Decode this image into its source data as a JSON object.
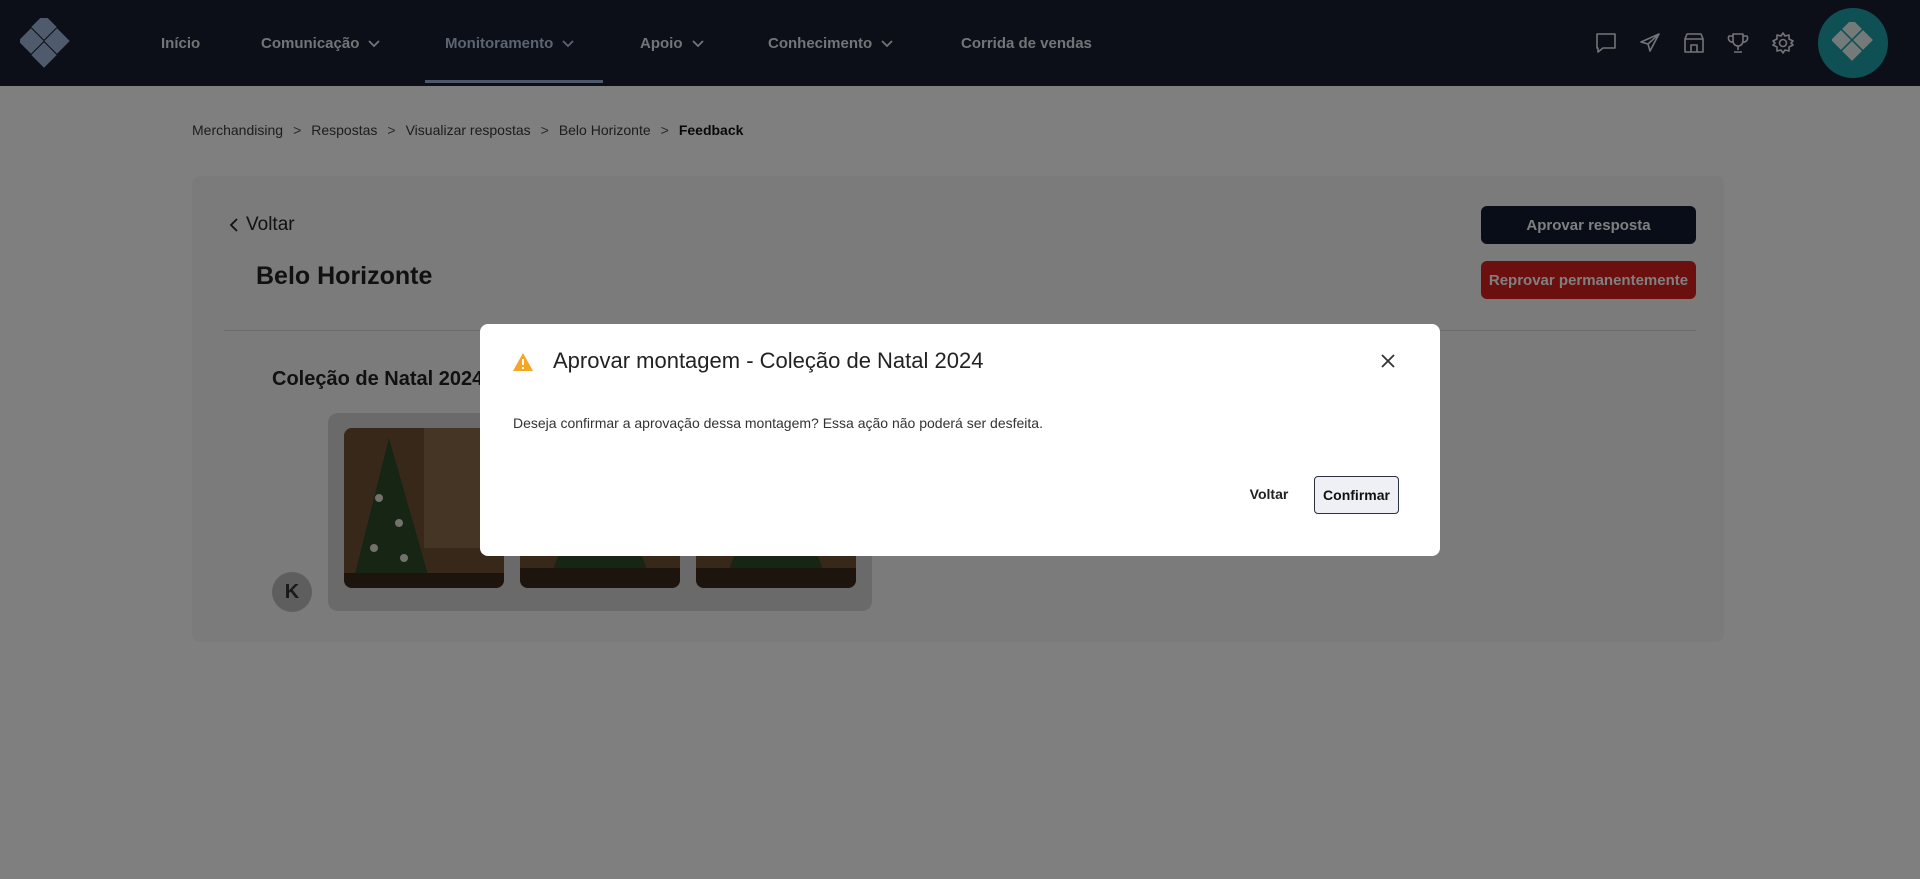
{
  "nav": {
    "items": [
      {
        "label": "Início"
      },
      {
        "label": "Comunicação"
      },
      {
        "label": "Monitoramento"
      },
      {
        "label": "Apoio"
      },
      {
        "label": "Conhecimento"
      },
      {
        "label": "Corrida de vendas"
      }
    ],
    "active_index": 2,
    "icons": [
      "chat-icon",
      "send-icon",
      "store-icon",
      "trophy-icon",
      "gear-icon"
    ]
  },
  "breadcrumb": {
    "items": [
      "Merchandising",
      "Respostas",
      "Visualizar respostas",
      "Belo Horizonte"
    ],
    "current": "Feedback",
    "separator": ">"
  },
  "page": {
    "back_label": "Voltar",
    "title": "Belo Horizonte",
    "approve_label": "Aprovar resposta",
    "reject_label": "Reprovar permanentemente",
    "section_title": "Coleção de Natal 2024",
    "user_initial": "K"
  },
  "modal": {
    "title": "Aprovar montagem - Coleção de Natal 2024",
    "message": "Deseja confirmar a aprovação dessa montagem? Essa ação não poderá ser desfeita.",
    "cancel_label": "Voltar",
    "confirm_label": "Confirmar"
  },
  "colors": {
    "topbar": "#1a1e30",
    "approve": "#111a2e",
    "reject": "#d81f1f",
    "warning": "#f5a623",
    "avatar_brand": "#1ea1a8"
  }
}
